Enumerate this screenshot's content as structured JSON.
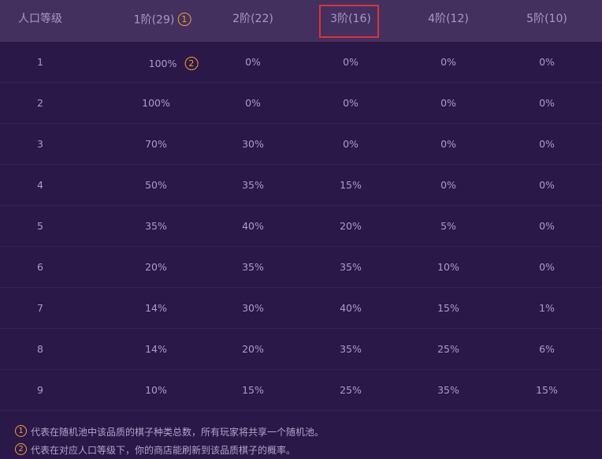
{
  "header": {
    "population_level": "人口等级",
    "tiers": [
      {
        "label": "1阶(29)",
        "badge": "1"
      },
      {
        "label": "2阶(22)"
      },
      {
        "label": "3阶(16)",
        "highlighted": true
      },
      {
        "label": "4阶(12)"
      },
      {
        "label": "5阶(10)"
      }
    ]
  },
  "rows": [
    {
      "level": "1",
      "values": [
        "100%",
        "0%",
        "0%",
        "0%",
        "0%"
      ],
      "badge": "2"
    },
    {
      "level": "2",
      "values": [
        "100%",
        "0%",
        "0%",
        "0%",
        "0%"
      ]
    },
    {
      "level": "3",
      "values": [
        "70%",
        "30%",
        "0%",
        "0%",
        "0%"
      ]
    },
    {
      "level": "4",
      "values": [
        "50%",
        "35%",
        "15%",
        "0%",
        "0%"
      ]
    },
    {
      "level": "5",
      "values": [
        "35%",
        "40%",
        "20%",
        "5%",
        "0%"
      ]
    },
    {
      "level": "6",
      "values": [
        "20%",
        "35%",
        "35%",
        "10%",
        "0%"
      ]
    },
    {
      "level": "7",
      "values": [
        "14%",
        "30%",
        "40%",
        "15%",
        "1%"
      ]
    },
    {
      "level": "8",
      "values": [
        "14%",
        "20%",
        "35%",
        "25%",
        "6%"
      ]
    },
    {
      "level": "9",
      "values": [
        "10%",
        "15%",
        "25%",
        "35%",
        "15%"
      ]
    }
  ],
  "footnotes": [
    {
      "badge": "1",
      "text": "代表在随机池中该品质的棋子种类总数，所有玩家将共享一个随机池。"
    },
    {
      "badge": "2",
      "text": "代表在对应人口等级下，你的商店能刷新到该品质棋子的概率。"
    }
  ],
  "colors": {
    "background": "#2a1848",
    "header_background": "#43305f",
    "badge": "#f0a030",
    "highlight_border": "#e0303a"
  },
  "icons": {
    "badge_1": "circled-number-1-icon",
    "badge_2": "circled-number-2-icon"
  }
}
